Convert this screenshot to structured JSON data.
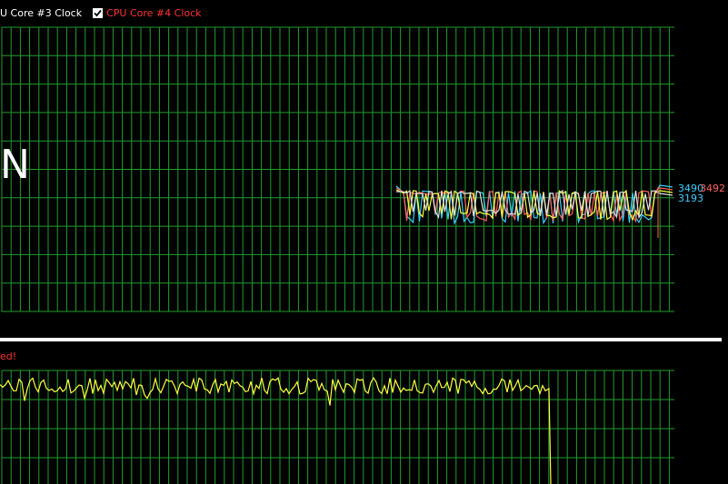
{
  "legend": {
    "core3_label": "U Core #3 Clock",
    "core4_label": "CPU Core #4 Clock",
    "core4_checked": true
  },
  "overlay_letter": "N",
  "readouts": {
    "core_a": "3490",
    "core_b": "3492",
    "core_c": "3193"
  },
  "lower_panel": {
    "warning_text": "ed!"
  },
  "colors": {
    "background": "#000000",
    "grid": "#1f9e2c",
    "series_cyan": "#3ad0ff",
    "series_red": "#ff6060",
    "series_yellow": "#ffff40",
    "series_white": "#e0e0e0",
    "warning": "#ff3030"
  }
}
